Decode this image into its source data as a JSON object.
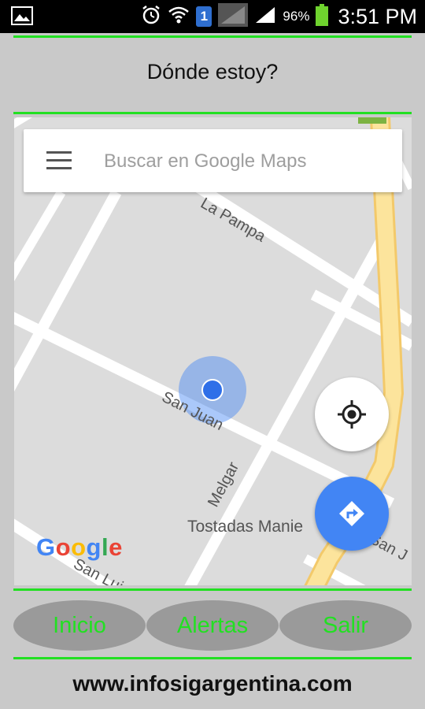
{
  "status_bar": {
    "battery": "96%",
    "time": "3:51 PM",
    "sim": "1"
  },
  "header": {
    "title": "Dónde estoy?"
  },
  "map": {
    "search_placeholder": "Buscar en Google Maps",
    "streets": [
      "La Pampa",
      "San Juan",
      "Melgar",
      "San Luis",
      "San J"
    ],
    "place": "Tostadas Manie",
    "logo": "Google",
    "logo_colors": [
      "#4285F4",
      "#EA4335",
      "#FBBC05",
      "#4285F4",
      "#34A853",
      "#EA4335"
    ]
  },
  "nav": {
    "inicio": "Inicio",
    "alertas": "Alertas",
    "salir": "Salir"
  },
  "footer": {
    "url": "www.infosigargentina.com"
  },
  "colors": {
    "accent_green": "#22e022",
    "map_bg": "#dcdcdc",
    "road_yellow": "#fce49c",
    "user_dot": "#4285f4"
  }
}
